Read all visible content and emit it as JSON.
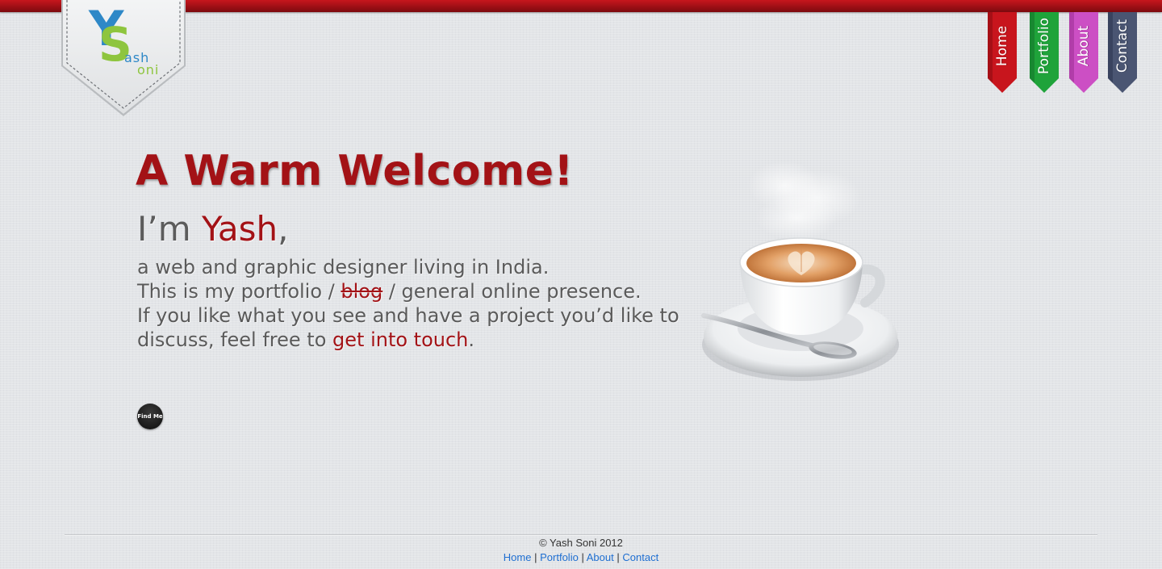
{
  "logo": {
    "letter_y": "Y",
    "letter_s": "S",
    "first": "ash",
    "last": "oni"
  },
  "nav": [
    {
      "label": "Home",
      "color": "#c8151d",
      "dark": "#8a0b10"
    },
    {
      "label": "Portfolio",
      "color": "#1fa33a",
      "dark": "#12722a"
    },
    {
      "label": "About",
      "color": "#cc4fc4",
      "dark": "#9a2f93"
    },
    {
      "label": "Contact",
      "color": "#4a5572",
      "dark": "#2c3550"
    }
  ],
  "main": {
    "heading": "A Warm Welcome!",
    "intro_prefix": "I’m ",
    "intro_name": "Yash",
    "intro_suffix": ",",
    "bio_line1": "a web and graphic designer living in India.",
    "bio_line2_a": "This is my portfolio / ",
    "bio_line2_strike": "blog",
    "bio_line2_b": " / general online presence.",
    "bio_line3_a": "If you like what you see and have a project you’d like to discuss, feel free to ",
    "bio_line3_link": "get into touch",
    "bio_line3_b": "."
  },
  "find_me": {
    "label": "Find Me"
  },
  "footer": {
    "copyright": "© Yash Soni 2012",
    "links": [
      "Home",
      "Portfolio",
      "About",
      "Contact"
    ],
    "separator": "|"
  },
  "colors": {
    "accent": "#a31216",
    "top_bar": "#c8161d",
    "link": "#1f6fd1"
  }
}
